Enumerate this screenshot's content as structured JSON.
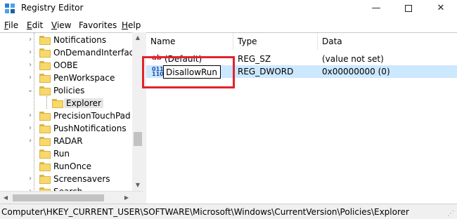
{
  "window": {
    "title": "Registry Editor",
    "minimize_glyph": "—",
    "close_glyph": "✕"
  },
  "menu": {
    "items": [
      {
        "accel": "F",
        "rest": "ile"
      },
      {
        "accel": "E",
        "rest": "dit"
      },
      {
        "accel": "V",
        "rest": "iew"
      },
      {
        "accel": "",
        "rest": "Favorites"
      },
      {
        "accel": "H",
        "rest": "elp"
      }
    ]
  },
  "tree": {
    "items": [
      {
        "label": "Notifications",
        "expander": "›"
      },
      {
        "label": "OnDemandInterfaceCache",
        "expander": "›"
      },
      {
        "label": "OOBE",
        "expander": "›"
      },
      {
        "label": "PenWorkspace",
        "expander": "›"
      },
      {
        "label": "Policies",
        "expander": "⌄"
      },
      {
        "label": "Explorer",
        "expander": ""
      },
      {
        "label": "PrecisionTouchPad",
        "expander": "›"
      },
      {
        "label": "PushNotifications",
        "expander": "›"
      },
      {
        "label": "RADAR",
        "expander": "›"
      },
      {
        "label": "Run",
        "expander": ""
      },
      {
        "label": "RunOnce",
        "expander": ""
      },
      {
        "label": "Screensavers",
        "expander": "›"
      },
      {
        "label": "Search",
        "expander": "›"
      }
    ],
    "scroll_up_glyph": "▲",
    "scroll_down_glyph": "▼",
    "scroll_left_glyph": "◀",
    "scroll_right_glyph": "▶"
  },
  "values": {
    "columns": {
      "name": "Name",
      "type": "Type",
      "data": "Data"
    },
    "rows": [
      {
        "icon": "ab",
        "name": "(Default)",
        "type": "REG_SZ",
        "data": "(value not set)"
      },
      {
        "icon": "011\n110",
        "name": "DisallowRun",
        "type": "REG_DWORD",
        "data": "0x00000000 (0)"
      }
    ],
    "rename_value": "DisallowRun"
  },
  "status": {
    "path": "Computer\\HKEY_CURRENT_USER\\SOFTWARE\\Microsoft\\Windows\\CurrentVersion\\Policies\\Explorer"
  },
  "colors": {
    "highlight_box": "#e0242c",
    "selected_row": "#cce8ff",
    "folder": "#f7d86c"
  }
}
